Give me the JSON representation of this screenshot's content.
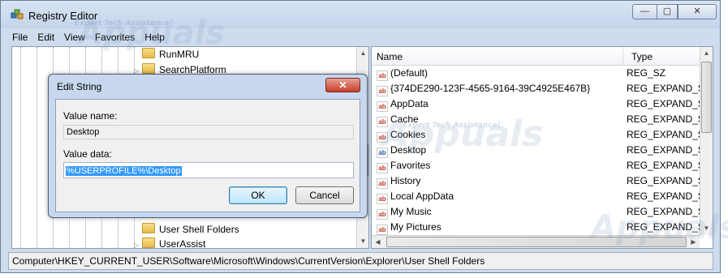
{
  "window": {
    "title": "Registry Editor",
    "icon": "registry-editor-icon",
    "buttons": {
      "minimize": "—",
      "maximize": "▢",
      "close": "✕"
    }
  },
  "menu": [
    "File",
    "Edit",
    "View",
    "Favorites",
    "Help"
  ],
  "tree": {
    "items": [
      {
        "label": "RunMRU",
        "expander": ""
      },
      {
        "label": "SearchPlatform",
        "expander": "▷"
      },
      {
        "label": "User Shell Folders",
        "expander": ""
      },
      {
        "label": "UserAssist",
        "expander": "▷"
      }
    ]
  },
  "list": {
    "columns": {
      "name": "Name",
      "type": "Type"
    },
    "rows": [
      {
        "name": "(Default)",
        "type": "REG_SZ",
        "icon": "ab-string-icon"
      },
      {
        "name": "{374DE290-123F-4565-9164-39C4925E467B}",
        "type": "REG_EXPAND_SZ",
        "icon": "ab-string-icon"
      },
      {
        "name": "AppData",
        "type": "REG_EXPAND_SZ",
        "icon": "ab-string-icon"
      },
      {
        "name": "Cache",
        "type": "REG_EXPAND_SZ",
        "icon": "ab-string-icon"
      },
      {
        "name": "Cookies",
        "type": "REG_EXPAND_SZ",
        "icon": "ab-string-icon"
      },
      {
        "name": "Desktop",
        "type": "REG_EXPAND_SZ",
        "icon": "ab-string-icon"
      },
      {
        "name": "Favorites",
        "type": "REG_EXPAND_SZ",
        "icon": "ab-string-icon"
      },
      {
        "name": "History",
        "type": "REG_EXPAND_SZ",
        "icon": "ab-string-icon"
      },
      {
        "name": "Local AppData",
        "type": "REG_EXPAND_SZ",
        "icon": "ab-string-icon"
      },
      {
        "name": "My Music",
        "type": "REG_EXPAND_SZ",
        "icon": "ab-string-icon"
      },
      {
        "name": "My Pictures",
        "type": "REG_EXPAND_SZ",
        "icon": "ab-string-icon"
      }
    ]
  },
  "status": "Computer\\HKEY_CURRENT_USER\\Software\\Microsoft\\Windows\\CurrentVersion\\Explorer\\User Shell Folders",
  "dialog": {
    "title": "Edit String",
    "close": "✕",
    "value_name_label": "Value name:",
    "value_name": "Desktop",
    "value_data_label": "Value data:",
    "value_data": "%USERPROFILE%\\Desktop",
    "ok": "OK",
    "cancel": "Cancel"
  },
  "watermark": {
    "brand": "Appuals",
    "tagline": "Expert Tech Assistance!"
  }
}
